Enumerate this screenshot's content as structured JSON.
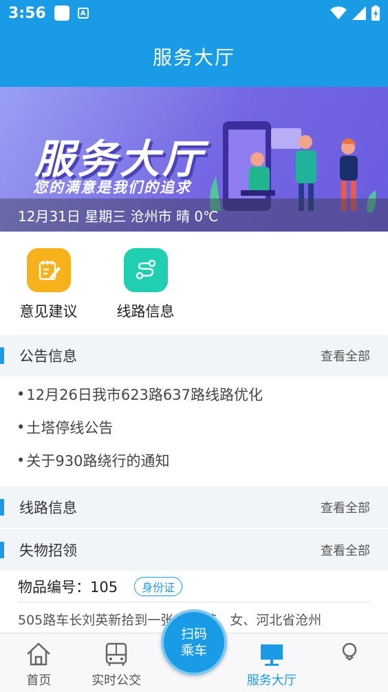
{
  "status_bar": {
    "time": "3:56",
    "app_indicator": "A"
  },
  "header": {
    "title": "服务大厅"
  },
  "banner": {
    "title": "服务大厅",
    "subtitle": "您的满意是我们的追求",
    "info": "12月31日 星期三 沧州市 晴 0℃"
  },
  "quick_actions": [
    {
      "label": "意见建议",
      "icon": "edit-note-icon",
      "color": "#f7b21b"
    },
    {
      "label": "线路信息",
      "icon": "route-icon",
      "color": "#1fcfb0"
    }
  ],
  "sections": {
    "notice": {
      "title": "公告信息",
      "more": "查看全部"
    },
    "routes": {
      "title": "线路信息",
      "more": "查看全部"
    },
    "lost": {
      "title": "失物招领",
      "more": "查看全部"
    }
  },
  "notices": [
    "12月26日我市623路637路线路优化",
    "土塔停线公告",
    "关于930路绕行的通知"
  ],
  "lost_item": {
    "label": "物品编号：105",
    "tag": "身份证",
    "desc": "505路车长刘英新拾到一张 谢桂芝、女、河北省沧州"
  },
  "tabbar": {
    "home": "首页",
    "realtime": "实时公交",
    "scan_line1": "扫码",
    "scan_line2": "乘车",
    "service": "服务大厅"
  },
  "colors": {
    "primary": "#1a9be6",
    "orange": "#f7b21b",
    "teal": "#1fcfb0"
  }
}
